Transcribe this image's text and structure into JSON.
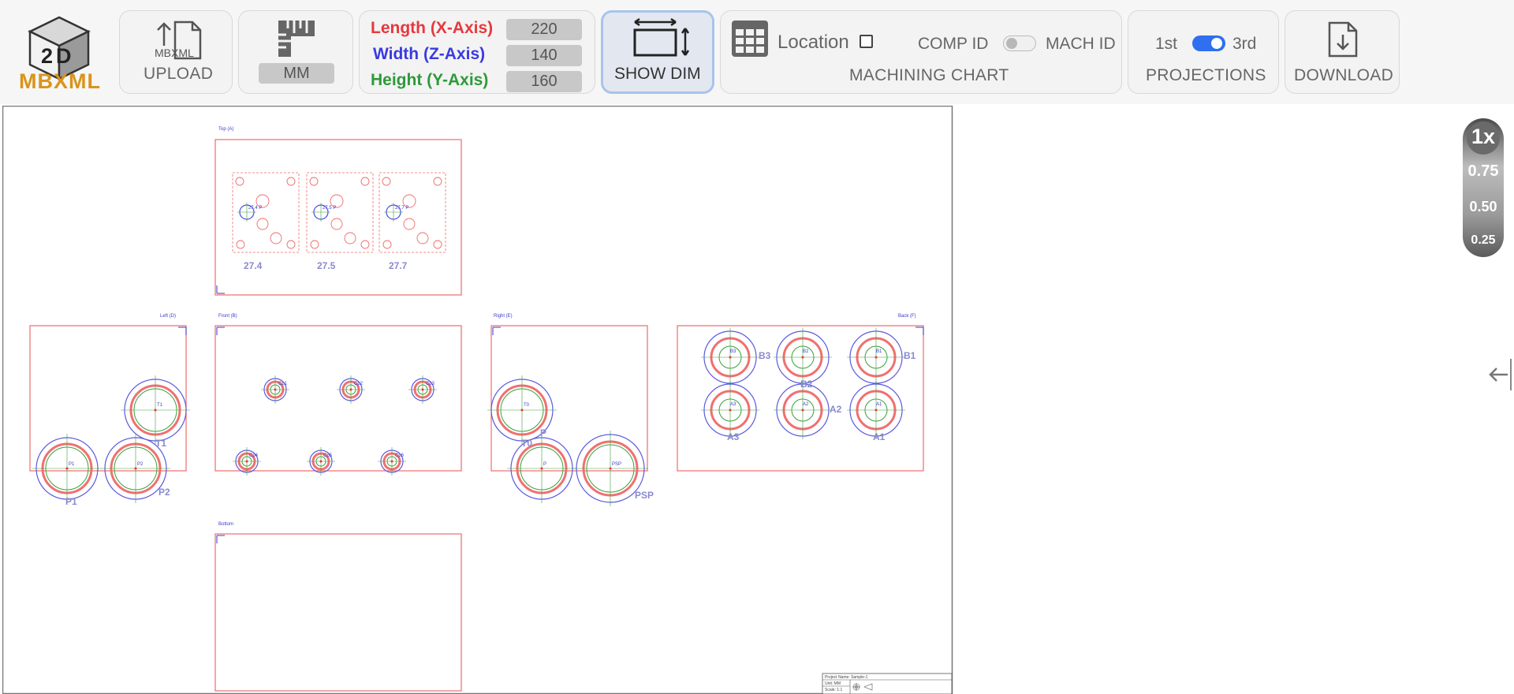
{
  "logo": {
    "badge": "2D",
    "text": "MBXML"
  },
  "upload": {
    "file_label": "MBXML",
    "label": "UPLOAD"
  },
  "units": {
    "value": "MM"
  },
  "dimensions": {
    "length": {
      "label": "Length (X-Axis)",
      "value": "220",
      "color": "#e8383d"
    },
    "width": {
      "label": "Width (Z-Axis)",
      "value": "140",
      "color": "#3a3ae0"
    },
    "height": {
      "label": "Height (Y-Axis)",
      "value": "160",
      "color": "#2e9a3a"
    }
  },
  "show_dim": {
    "label": "SHOW DIM",
    "active": true
  },
  "machining": {
    "location_label": "Location",
    "location_checked": false,
    "comp_id_label": "COMP ID",
    "mach_id_label": "MACH ID",
    "toggle_on": false,
    "title": "MACHINING CHART"
  },
  "projections": {
    "first_label": "1st",
    "third_label": "3rd",
    "toggle_on": true,
    "title": "PROJECTIONS"
  },
  "download": {
    "label": "DOWNLOAD"
  },
  "zoom": {
    "levels": [
      "1x",
      "0.75",
      "0.50",
      "0.25"
    ],
    "selected": "1x"
  },
  "drawing": {
    "views": {
      "top": "Top (A)",
      "left": "Left (D)",
      "front": "Front (B)",
      "right": "Right (E)",
      "back": "Back (F)",
      "bottom": "Bottom"
    },
    "top_groups": [
      "27.4",
      "27.5",
      "27.7"
    ],
    "top_small_labels": [
      "27.4 P",
      "27.5 P",
      "27.7 P"
    ],
    "left_labels": [
      "T1",
      "P1",
      "P2"
    ],
    "left_big_labels": [
      "T1",
      "P1",
      "P2"
    ],
    "front_labels": [
      "Cp1",
      "Cp2",
      "Cp3",
      "Cp4",
      "Cp5",
      "Cp6"
    ],
    "right_labels": [
      "T0",
      "P",
      "PSP"
    ],
    "right_big_labels": [
      "T0",
      "P",
      "PSP"
    ],
    "back_labels": [
      "B3",
      "B2",
      "B1",
      "A3",
      "A2",
      "A1"
    ],
    "title_block": {
      "project": "Project Name: Sample-1",
      "unit": "Unit: MM",
      "scale": "Scale: 1:1"
    }
  },
  "colors": {
    "accent": "#2f6ff0",
    "drawing_red": "#f06b6b",
    "drawing_blue": "#5a5adf",
    "drawing_green": "#3aa03a",
    "brand_orange": "#d9941c"
  }
}
